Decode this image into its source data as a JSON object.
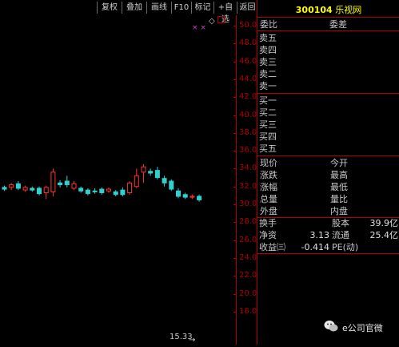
{
  "toolbar": {
    "buttons": [
      "复权",
      "叠加",
      "画线",
      "F10",
      "标记",
      "+自选",
      "返回"
    ]
  },
  "price_axis": {
    "ticks": [
      "50.00",
      "48.00",
      "46.00",
      "44.00",
      "42.00",
      "40.00",
      "38.00",
      "36.00",
      "34.00",
      "32.00",
      "30.00",
      "28.00",
      "26.00",
      "24.00",
      "22.00",
      "20.00",
      "18.00"
    ]
  },
  "chart_data": {
    "type": "candlestick",
    "ylim": [
      17,
      51
    ],
    "up_color": "#ff3030",
    "down_color": "#30d0d0",
    "candles": [
      {
        "o": 31.9,
        "c": 31.7,
        "h": 32.1,
        "l": 31.5
      },
      {
        "o": 31.9,
        "c": 32.2,
        "h": 32.4,
        "l": 31.6
      },
      {
        "o": 32.3,
        "c": 31.8,
        "h": 32.6,
        "l": 31.6
      },
      {
        "o": 31.6,
        "c": 31.9,
        "h": 32.1,
        "l": 31.4
      },
      {
        "o": 31.8,
        "c": 31.6,
        "h": 32.0,
        "l": 31.4
      },
      {
        "o": 31.8,
        "c": 31.2,
        "h": 32.0,
        "l": 31.0
      },
      {
        "o": 31.3,
        "c": 31.9,
        "h": 32.1,
        "l": 30.6
      },
      {
        "o": 31.4,
        "c": 33.6,
        "h": 34.0,
        "l": 30.9
      },
      {
        "o": 32.4,
        "c": 32.2,
        "h": 32.7,
        "l": 31.9
      },
      {
        "o": 32.6,
        "c": 32.2,
        "h": 33.2,
        "l": 31.9
      },
      {
        "o": 31.8,
        "c": 32.3,
        "h": 32.6,
        "l": 31.6
      },
      {
        "o": 31.8,
        "c": 31.5,
        "h": 32.0,
        "l": 31.3
      },
      {
        "o": 31.6,
        "c": 31.2,
        "h": 31.8,
        "l": 31.0
      },
      {
        "o": 31.5,
        "c": 31.4,
        "h": 31.8,
        "l": 31.2
      },
      {
        "o": 31.7,
        "c": 31.3,
        "h": 31.9,
        "l": 31.1
      },
      {
        "o": 31.5,
        "c": 31.7,
        "h": 31.9,
        "l": 31.3
      },
      {
        "o": 31.4,
        "c": 31.1,
        "h": 31.6,
        "l": 30.9
      },
      {
        "o": 31.6,
        "c": 31.1,
        "h": 31.9,
        "l": 30.9
      },
      {
        "o": 31.3,
        "c": 32.4,
        "h": 32.6,
        "l": 31.1
      },
      {
        "o": 32.0,
        "c": 33.2,
        "h": 34.0,
        "l": 31.8
      },
      {
        "o": 33.6,
        "c": 34.2,
        "h": 34.5,
        "l": 32.4
      },
      {
        "o": 33.7,
        "c": 33.5,
        "h": 34.0,
        "l": 33.2
      },
      {
        "o": 33.8,
        "c": 33.0,
        "h": 34.2,
        "l": 32.8
      },
      {
        "o": 32.9,
        "c": 32.4,
        "h": 33.2,
        "l": 32.0
      },
      {
        "o": 32.6,
        "c": 31.7,
        "h": 32.8,
        "l": 31.5
      },
      {
        "o": 31.5,
        "c": 30.9,
        "h": 31.8,
        "l": 30.7
      },
      {
        "o": 31.1,
        "c": 30.8,
        "h": 31.3,
        "l": 30.6
      },
      {
        "o": 30.8,
        "c": 30.9,
        "h": 31.1,
        "l": 30.6
      },
      {
        "o": 30.9,
        "c": 30.5,
        "h": 31.1,
        "l": 30.3
      }
    ],
    "low_marker": "15.33"
  },
  "panel": {
    "code": "300104",
    "name": "乐视网",
    "weibi_label": "委比",
    "weicha_label": "委差",
    "sell_labels": [
      "卖五",
      "卖四",
      "卖三",
      "卖二",
      "卖一"
    ],
    "buy_labels": [
      "买一",
      "买二",
      "买三",
      "买四",
      "买五"
    ],
    "stats_left": [
      "现价",
      "涨跌",
      "涨幅",
      "总量",
      "外盘"
    ],
    "stats_right": [
      "今开",
      "最高",
      "最低",
      "量比",
      "内盘"
    ],
    "fund_rows": [
      {
        "l": "换手",
        "v1": "",
        "m": "股本",
        "v2": "39.9亿"
      },
      {
        "l": "净资",
        "v1": "3.13",
        "m": "流通",
        "v2": "25.4亿"
      },
      {
        "l": "收益㈢",
        "v1": "-0.414",
        "m": "PE(动)",
        "v2": ""
      }
    ]
  },
  "brand": {
    "text": "e公司官微"
  },
  "colors": {
    "axis": "#b00000",
    "code": "#ffff00",
    "marker": "#cc44cc"
  }
}
